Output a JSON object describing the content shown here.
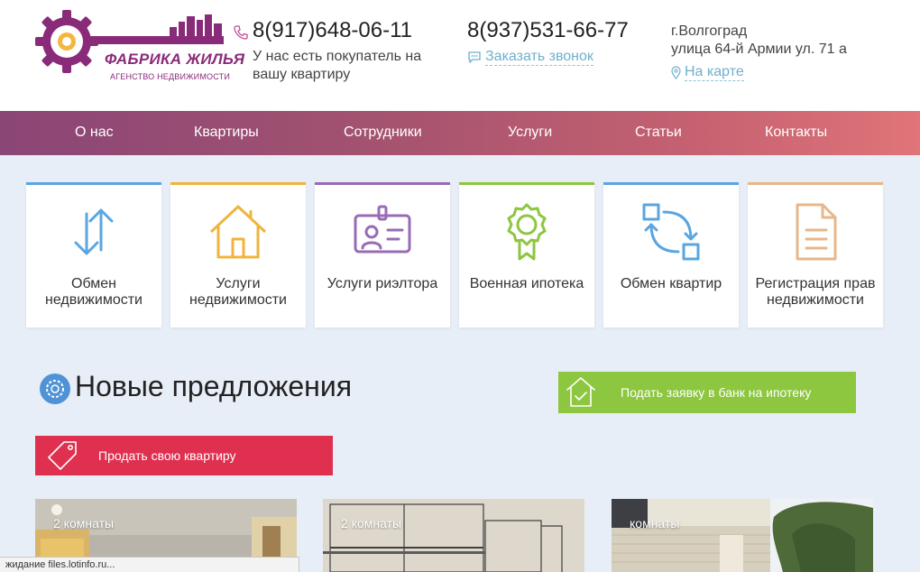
{
  "header": {
    "logo": {
      "title": "ФАБРИКА ЖИЛЬЯ",
      "subtitle": "АГЕНСТВО НЕДВИЖИМОСТИ"
    },
    "phone1": "8(917)648-06-11",
    "buyer_text": "У нас есть покупатель на вашу квартиру",
    "phone2": "8(937)531-66-77",
    "callback_label": "Заказать звонок",
    "city": "г.Волгоград",
    "street": "улица 64-й Армии ул. 71 а",
    "map_label": "На карте"
  },
  "nav": {
    "items": [
      {
        "label": "О нас"
      },
      {
        "label": "Квартиры"
      },
      {
        "label": "Сотрудники"
      },
      {
        "label": "Услуги"
      },
      {
        "label": "Статьи"
      },
      {
        "label": "Контакты"
      }
    ]
  },
  "services": [
    {
      "label": "Обмен недвижимости",
      "icon": "exchange-arrows-icon",
      "color": "#5aa6e0"
    },
    {
      "label": "Услуги недвижимости",
      "icon": "house-icon",
      "color": "#f0b43c"
    },
    {
      "label": "Услуги риэлтора",
      "icon": "id-card-icon",
      "color": "#9a6bb5"
    },
    {
      "label": "Военная ипотека",
      "icon": "award-badge-icon",
      "color": "#8dc63f"
    },
    {
      "label": "Обмен квартир",
      "icon": "swap-squares-icon",
      "color": "#5aa6e0"
    },
    {
      "label": "Регистрация прав недвижимости",
      "icon": "document-icon",
      "color": "#e7b78a"
    }
  ],
  "offers": {
    "title": "Новые предложения",
    "mortgage_button": "Подать заявку в банк на ипотеку",
    "sell_button": "Продать свою квартиру",
    "listings": [
      {
        "rooms": "2 комнаты"
      },
      {
        "rooms": "2 комнаты"
      },
      {
        "rooms": "комнаты"
      }
    ]
  },
  "status_bar": "жидание files.lotinfo.ru...",
  "colors": {
    "brand": "#8a2b7a",
    "nav_gradient_start": "#8a4677",
    "nav_gradient_end": "#e07478",
    "link": "#6fb0cc",
    "mortgage_green": "#8dc63f",
    "sell_red": "#e03050"
  }
}
